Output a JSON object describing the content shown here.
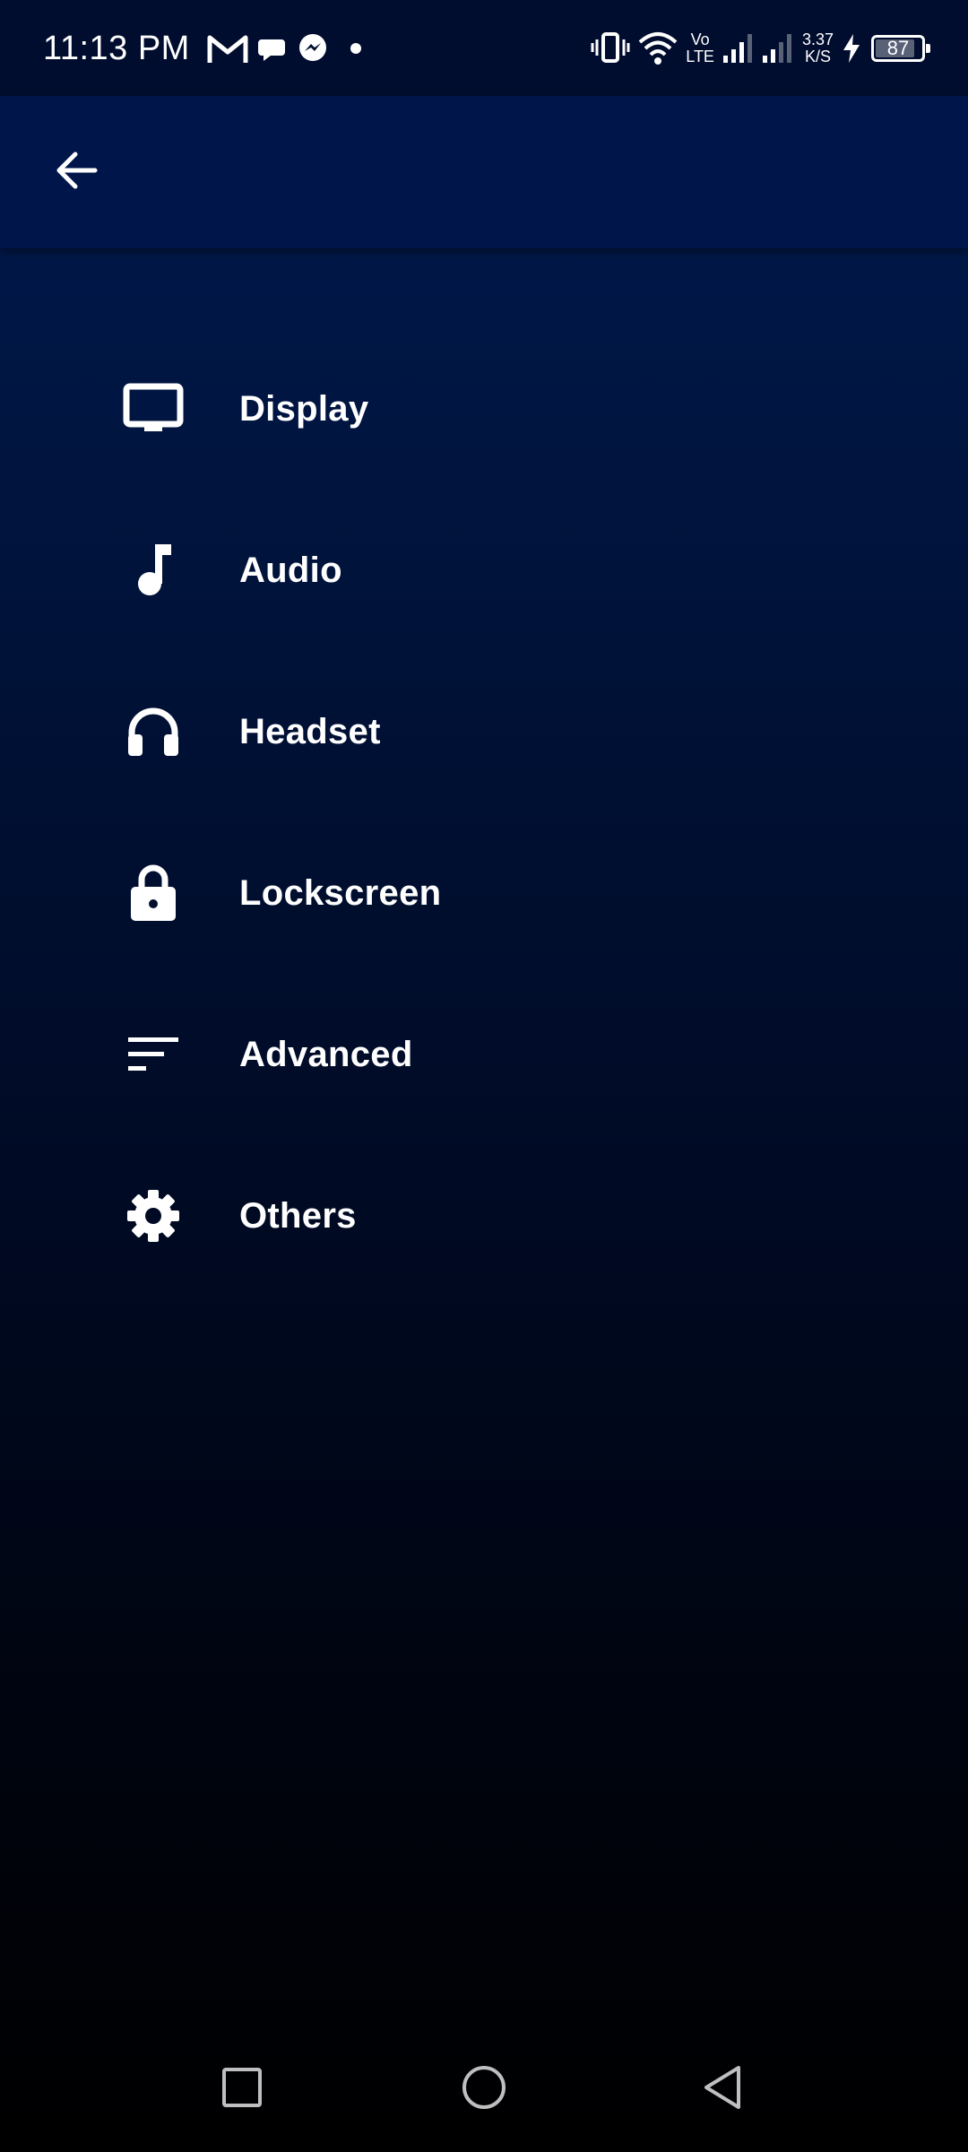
{
  "status_bar": {
    "time": "11:13 PM",
    "notification_icons": [
      "gmail-icon",
      "chat-bubble-icon",
      "messenger-icon",
      "dot-icon"
    ],
    "volte_top": "Vo",
    "volte_bottom": "LTE",
    "speed_value": "3.37",
    "speed_unit": "K/S",
    "battery_level": "87",
    "battery_fraction": 0.87,
    "charging": true
  },
  "app_bar": {
    "back_icon": "arrow-left-icon"
  },
  "menu": {
    "items": [
      {
        "label": "Display",
        "icon": "monitor-icon"
      },
      {
        "label": "Audio",
        "icon": "music-note-icon"
      },
      {
        "label": "Headset",
        "icon": "headphones-icon"
      },
      {
        "label": "Lockscreen",
        "icon": "lock-icon"
      },
      {
        "label": "Advanced",
        "icon": "sort-lines-icon"
      },
      {
        "label": "Others",
        "icon": "gear-icon"
      }
    ]
  },
  "nav_bar": {
    "buttons": [
      "recents-square-icon",
      "home-circle-icon",
      "back-triangle-icon"
    ]
  },
  "colors": {
    "status_bar_bg": "#000d2e",
    "app_bar_bg": "#00154a",
    "text": "#ffffff"
  }
}
